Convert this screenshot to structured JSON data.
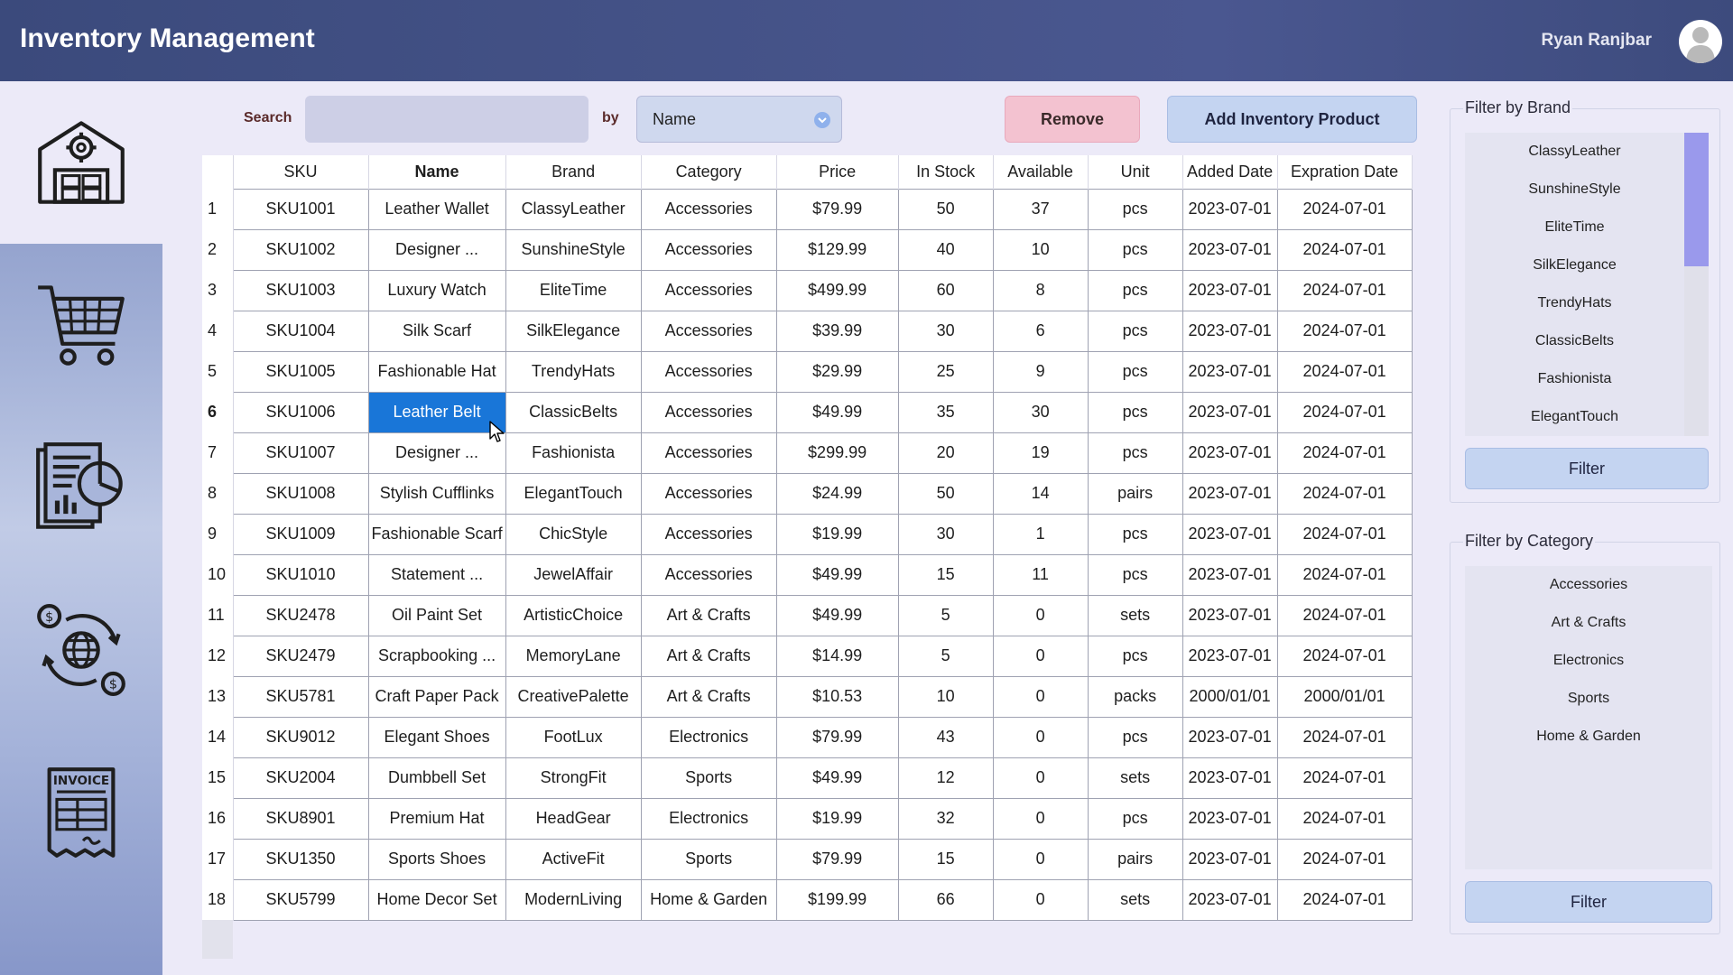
{
  "header": {
    "title": "Inventory Management",
    "user_name": "Ryan Ranjbar"
  },
  "sidebar": {
    "items": [
      {
        "name": "warehouse-icon",
        "active": true
      },
      {
        "name": "cart-icon",
        "active": false
      },
      {
        "name": "report-icon",
        "active": false
      },
      {
        "name": "currency-exchange-icon",
        "active": false
      },
      {
        "name": "invoice-icon",
        "active": false
      }
    ],
    "invoice_text": "INVOICE"
  },
  "toolbar": {
    "search_label": "Search",
    "search_value": "",
    "by_label": "by",
    "search_by": "Name",
    "remove_label": "Remove",
    "add_label": "Add Inventory Product"
  },
  "table": {
    "columns": [
      "SKU",
      "Name",
      "Brand",
      "Category",
      "Price",
      "In Stock",
      "Available",
      "Unit",
      "Added Date",
      "Expration Date"
    ],
    "selected_row": 6,
    "rows": [
      [
        "1",
        "SKU1001",
        "Leather Wallet",
        "ClassyLeather",
        "Accessories",
        "$79.99",
        "50",
        "37",
        "pcs",
        "2023-07-01",
        "2024-07-01"
      ],
      [
        "2",
        "SKU1002",
        "Designer ...",
        "SunshineStyle",
        "Accessories",
        "$129.99",
        "40",
        "10",
        "pcs",
        "2023-07-01",
        "2024-07-01"
      ],
      [
        "3",
        "SKU1003",
        "Luxury Watch",
        "EliteTime",
        "Accessories",
        "$499.99",
        "60",
        "8",
        "pcs",
        "2023-07-01",
        "2024-07-01"
      ],
      [
        "4",
        "SKU1004",
        "Silk Scarf",
        "SilkElegance",
        "Accessories",
        "$39.99",
        "30",
        "6",
        "pcs",
        "2023-07-01",
        "2024-07-01"
      ],
      [
        "5",
        "SKU1005",
        "Fashionable Hat",
        "TrendyHats",
        "Accessories",
        "$29.99",
        "25",
        "9",
        "pcs",
        "2023-07-01",
        "2024-07-01"
      ],
      [
        "6",
        "SKU1006",
        "Leather Belt",
        "ClassicBelts",
        "Accessories",
        "$49.99",
        "35",
        "30",
        "pcs",
        "2023-07-01",
        "2024-07-01"
      ],
      [
        "7",
        "SKU1007",
        "Designer ...",
        "Fashionista",
        "Accessories",
        "$299.99",
        "20",
        "19",
        "pcs",
        "2023-07-01",
        "2024-07-01"
      ],
      [
        "8",
        "SKU1008",
        "Stylish Cufflinks",
        "ElegantTouch",
        "Accessories",
        "$24.99",
        "50",
        "14",
        "pairs",
        "2023-07-01",
        "2024-07-01"
      ],
      [
        "9",
        "SKU1009",
        "Fashionable Scarf",
        "ChicStyle",
        "Accessories",
        "$19.99",
        "30",
        "1",
        "pcs",
        "2023-07-01",
        "2024-07-01"
      ],
      [
        "10",
        "SKU1010",
        "Statement ...",
        "JewelAffair",
        "Accessories",
        "$49.99",
        "15",
        "11",
        "pcs",
        "2023-07-01",
        "2024-07-01"
      ],
      [
        "11",
        "SKU2478",
        "Oil Paint Set",
        "ArtisticChoice",
        "Art & Crafts",
        "$49.99",
        "5",
        "0",
        "sets",
        "2023-07-01",
        "2024-07-01"
      ],
      [
        "12",
        "SKU2479",
        "Scrapbooking ...",
        "MemoryLane",
        "Art & Crafts",
        "$14.99",
        "5",
        "0",
        "pcs",
        "2023-07-01",
        "2024-07-01"
      ],
      [
        "13",
        "SKU5781",
        "Craft Paper Pack",
        "CreativePalette",
        "Art & Crafts",
        "$10.53",
        "10",
        "0",
        "packs",
        "2000/01/01",
        "2000/01/01"
      ],
      [
        "14",
        "SKU9012",
        "Elegant Shoes",
        "FootLux",
        "Electronics",
        "$79.99",
        "43",
        "0",
        "pcs",
        "2023-07-01",
        "2024-07-01"
      ],
      [
        "15",
        "SKU2004",
        "Dumbbell Set",
        "StrongFit",
        "Sports",
        "$49.99",
        "12",
        "0",
        "sets",
        "2023-07-01",
        "2024-07-01"
      ],
      [
        "16",
        "SKU8901",
        "Premium Hat",
        "HeadGear",
        "Electronics",
        "$19.99",
        "32",
        "0",
        "pcs",
        "2023-07-01",
        "2024-07-01"
      ],
      [
        "17",
        "SKU1350",
        "Sports Shoes",
        "ActiveFit",
        "Sports",
        "$79.99",
        "15",
        "0",
        "pairs",
        "2023-07-01",
        "2024-07-01"
      ],
      [
        "18",
        "SKU5799",
        "Home Decor Set",
        "ModernLiving",
        "Home & Garden",
        "$199.99",
        "66",
        "0",
        "sets",
        "2023-07-01",
        "2024-07-01"
      ]
    ]
  },
  "filter_brand": {
    "title": "Filter by Brand",
    "items": [
      "ClassyLeather",
      "SunshineStyle",
      "EliteTime",
      "SilkElegance",
      "TrendyHats",
      "ClassicBelts",
      "Fashionista",
      "ElegantTouch"
    ],
    "button_label": "Filter"
  },
  "filter_category": {
    "title": "Filter by Category",
    "items": [
      "Accessories",
      "Art & Crafts",
      "Electronics",
      "Sports",
      "Home & Garden"
    ],
    "button_label": "Filter"
  },
  "colors": {
    "header_bg": "#445287",
    "selected_cell": "#1976d8",
    "remove_button": "#f3c2d0",
    "primary_button": "#c4d4f1",
    "scroll_thumb": "#9a99ec"
  }
}
